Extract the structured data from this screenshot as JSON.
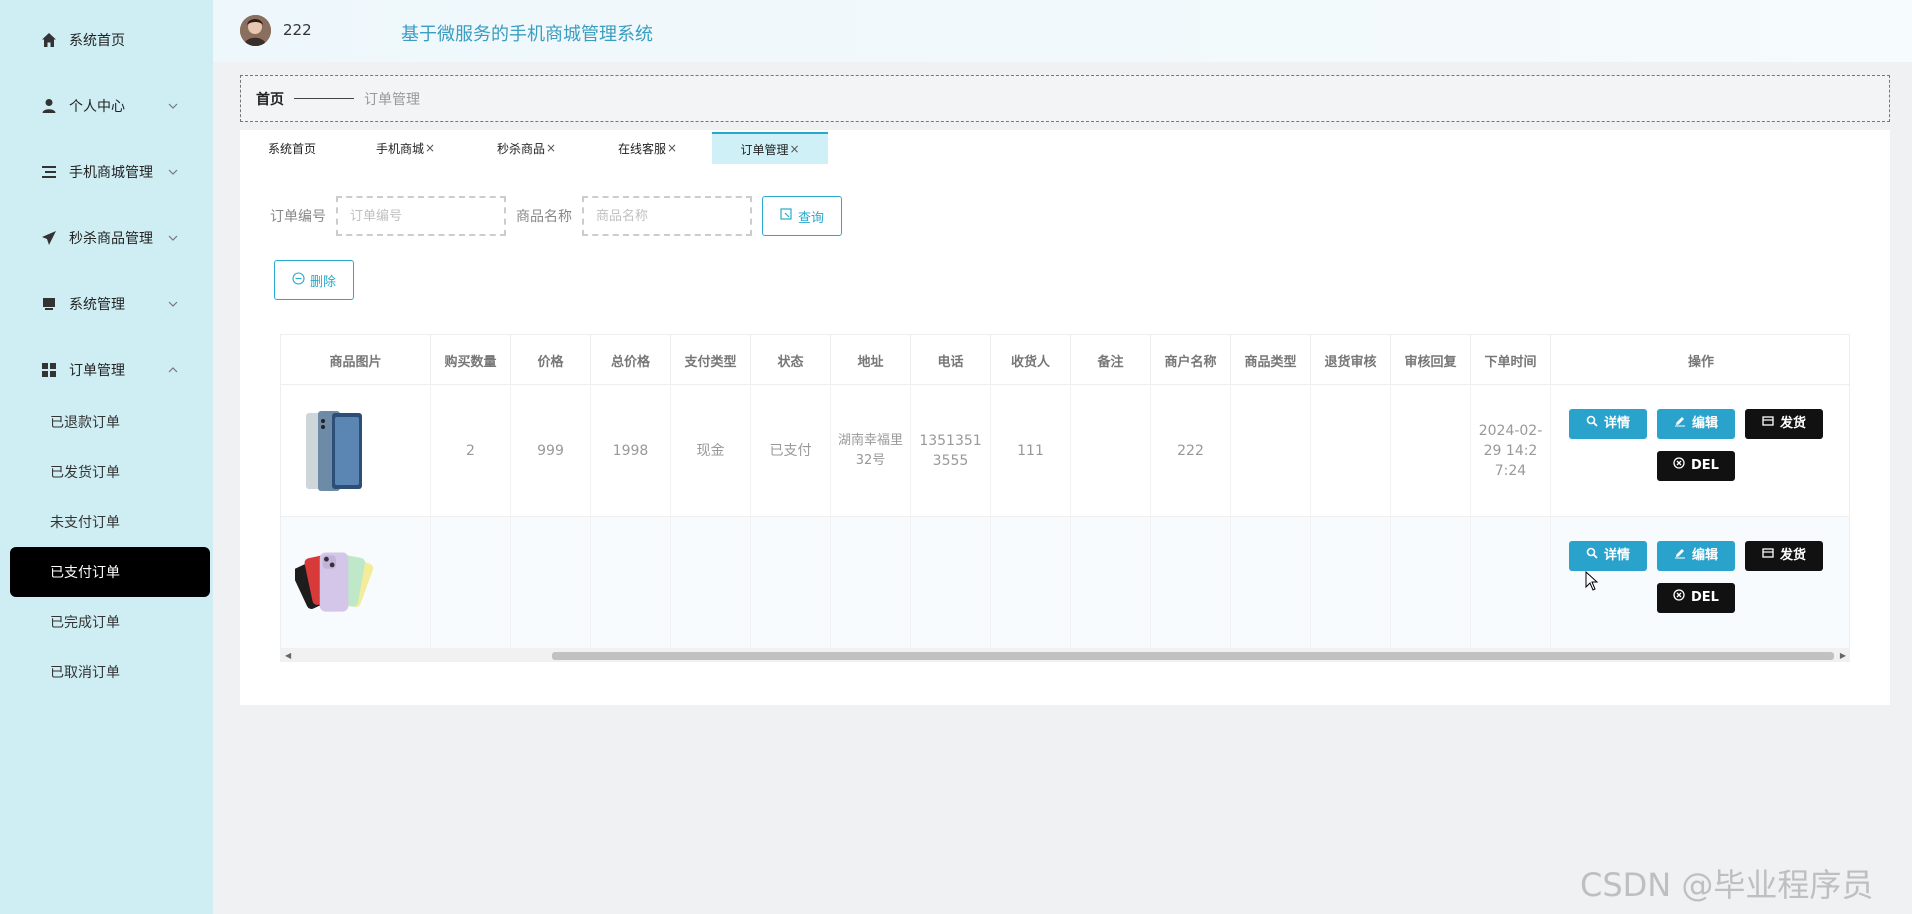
{
  "sidebar": {
    "items": [
      {
        "label": "系统首页",
        "icon": "home-icon"
      },
      {
        "label": "个人中心",
        "icon": "user-icon"
      },
      {
        "label": "手机商城管理",
        "icon": "list-icon"
      },
      {
        "label": "秒杀商品管理",
        "icon": "send-icon"
      },
      {
        "label": "系统管理",
        "icon": "monitor-icon"
      },
      {
        "label": "订单管理",
        "icon": "grid-icon"
      }
    ],
    "sub_items": [
      "已退款订单",
      "已发货订单",
      "未支付订单",
      "已支付订单",
      "已完成订单",
      "已取消订单"
    ],
    "active_sub": "已支付订单"
  },
  "header": {
    "username": "222",
    "system_title": "基于微服务的手机商城管理系统"
  },
  "breadcrumb": {
    "home": "首页",
    "current": "订单管理"
  },
  "tabs": [
    {
      "label": "系统首页",
      "closable": false
    },
    {
      "label": "手机商城",
      "closable": true
    },
    {
      "label": "秒杀商品",
      "closable": true
    },
    {
      "label": "在线客服",
      "closable": true
    },
    {
      "label": "订单管理",
      "closable": true,
      "active": true
    }
  ],
  "close_glyph": "×",
  "search": {
    "order_no_label": "订单编号",
    "order_no_placeholder": "订单编号",
    "product_name_label": "商品名称",
    "product_name_placeholder": "商品名称",
    "query_button": "查询"
  },
  "delete_button": "删除",
  "table": {
    "columns": [
      "商品图片",
      "购买数量",
      "价格",
      "总价格",
      "支付类型",
      "状态",
      "地址",
      "电话",
      "收货人",
      "备注",
      "商户名称",
      "商品类型",
      "退货审核",
      "审核回复",
      "下单时间",
      "操作"
    ],
    "rows": [
      {
        "image": "xiaomi-phone",
        "quantity": "2",
        "price": "999",
        "total": "1998",
        "pay_type": "现金",
        "status": "已支付",
        "address": "湖南幸福里32号",
        "phone": "13513513555",
        "receiver": "111",
        "note": "",
        "merchant": "222",
        "product_type": "",
        "return_review": "",
        "review_reply": "",
        "order_time": "2024-02-29 14:27:24"
      },
      {
        "image": "iphone-colors",
        "quantity": "",
        "price": "",
        "total": "",
        "pay_type": "",
        "status": "",
        "address": "",
        "phone": "",
        "receiver": "",
        "note": "",
        "merchant": "",
        "product_type": "",
        "return_review": "",
        "review_reply": "",
        "order_time": ""
      }
    ],
    "actions": {
      "detail": "详情",
      "edit": "编辑",
      "ship": "发货",
      "del": "DEL"
    }
  },
  "watermark": "CSDN @毕业程序员",
  "colors": {
    "accent": "#29a3cc",
    "sidebar_bg": "#cfeef4",
    "active_bg": "#000000"
  }
}
